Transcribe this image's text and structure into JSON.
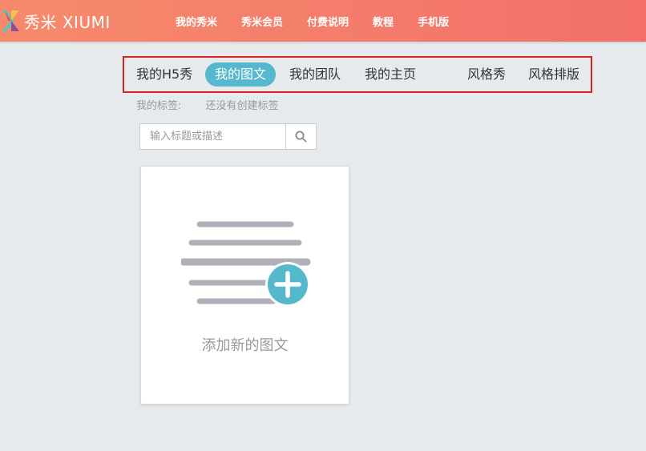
{
  "header": {
    "brand": "秀米 XIUMI",
    "nav": [
      "我的秀米",
      "秀米会员",
      "付费说明",
      "教程",
      "手机版"
    ]
  },
  "tabs": {
    "h5": "我的H5秀",
    "articles": "我的图文",
    "team": "我的团队",
    "homepage": "我的主页",
    "style_show": "风格秀",
    "style_layout": "风格排版",
    "active": "我的图文"
  },
  "tags": {
    "label": "我的标签:",
    "empty": "还没有创建标签"
  },
  "search": {
    "placeholder": "输入标题或描述",
    "value": ""
  },
  "new_card": {
    "label": "添加新的图文"
  },
  "colors": {
    "header_gradient": [
      "#f68a6b",
      "#f26f6a"
    ],
    "accent": "#55b8cc",
    "highlight_border": "#e02020",
    "line_gray": "#b0b0b8"
  }
}
